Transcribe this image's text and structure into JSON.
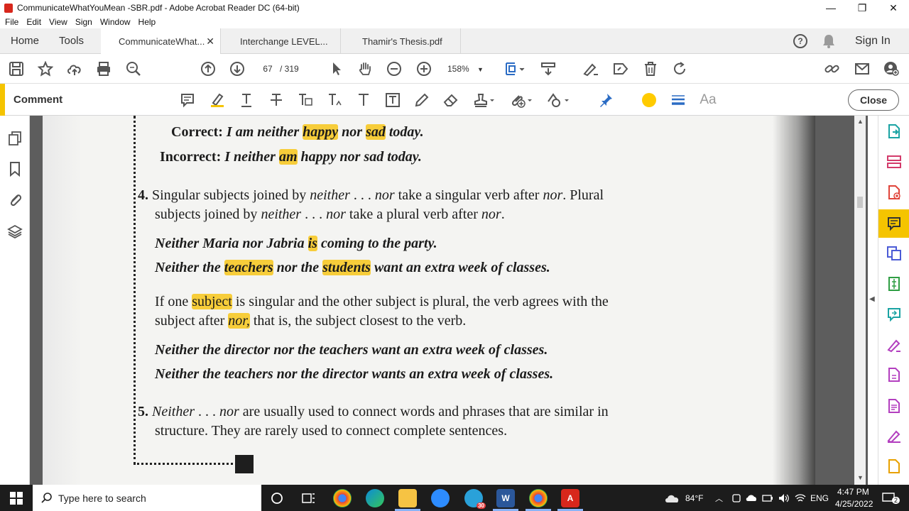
{
  "window": {
    "title": "CommunicateWhatYouMean -SBR.pdf - Adobe Acrobat Reader DC (64-bit)",
    "minimize": "—",
    "restore": "❐",
    "close": "✕"
  },
  "menu": [
    "File",
    "Edit",
    "View",
    "Sign",
    "Window",
    "Help"
  ],
  "tabs": {
    "home": "Home",
    "tools": "Tools",
    "docs": [
      {
        "label": "CommunicateWhat...",
        "active": true
      },
      {
        "label": "Interchange LEVEL...",
        "active": false
      },
      {
        "label": "Thamir's Thesis.pdf",
        "active": false
      }
    ],
    "close_glyph": "✕",
    "help": "?",
    "sign_in": "Sign In"
  },
  "toolbar": {
    "page_current": "67",
    "page_total": "/ 319",
    "zoom": "158%"
  },
  "comment_bar": {
    "label": "Comment",
    "close": "Close",
    "font_glyph": "Aa",
    "accent_color": "#f5c400",
    "highlight_color": "#ffcb00"
  },
  "document": {
    "lines": {
      "l1_label": "Correct:",
      "l1_a": "I am neither ",
      "l1_h1": "happy",
      "l1_b": " nor ",
      "l1_h2": "sad",
      "l1_c": " today.",
      "l2_label": "Incorrect:",
      "l2_a": "I neither ",
      "l2_h1": "am",
      "l2_b": " happy nor sad today.",
      "p4_num": "4.",
      "p4_line1_a": "Singular subjects joined by ",
      "p4_line1_i1": "neither",
      "p4_line1_b": " . . . ",
      "p4_line1_i2": "nor",
      "p4_line1_c": " take a singular verb after ",
      "p4_line1_i3": "nor",
      "p4_line1_d": ". Plural",
      "p4_line2_a": "subjects joined by ",
      "p4_line2_i1": "neither",
      "p4_line2_b": " . . . ",
      "p4_line2_i2": "nor",
      "p4_line2_c": " take a plural verb after ",
      "p4_line2_i3": "nor",
      "p4_line2_d": ".",
      "ex1_a": "Neither Maria nor Jabria ",
      "ex1_h": "is",
      "ex1_b": " coming to the party.",
      "ex2_a": "Neither the ",
      "ex2_h1": "teachers",
      "ex2_b": " nor the ",
      "ex2_h2": "students",
      "ex2_c": " want an extra week of classes.",
      "p_if_a": "If one ",
      "p_if_h": "subject",
      "p_if_b": " is singular and the other subject is plural, the verb agrees with the",
      "p_if2_a": "subject after ",
      "p_if2_h": "nor,",
      "p_if2_b": " that is, the subject closest to the verb.",
      "ex3": "Neither the director nor the teachers want an extra week of classes.",
      "ex4": "Neither the teachers nor the director wants an extra week of classes.",
      "p5_num": "5.",
      "p5_i1": "Neither",
      "p5_a": " . . . ",
      "p5_i2": "nor",
      "p5_b": " are usually used to connect words and phrases that are similar in",
      "p5_line2": "structure. They are rarely used to connect complete sentences."
    }
  },
  "taskbar": {
    "search_placeholder": "Type here to search",
    "weather": "84°F",
    "lang": "ENG",
    "time": "4:47 PM",
    "date": "4/25/2022",
    "notif_count": "2",
    "badge_count": "30"
  }
}
